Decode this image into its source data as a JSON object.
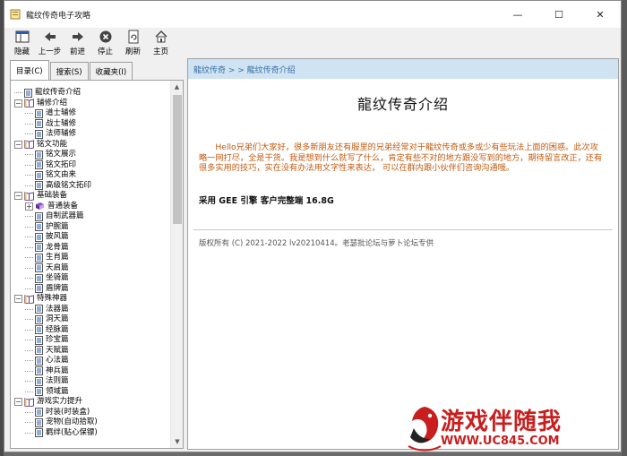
{
  "window": {
    "title": "龍纹传奇电子攻略"
  },
  "window_controls": {
    "minimize": "—",
    "maximize": "☐",
    "close": "✕"
  },
  "toolbar": {
    "hide": "隐藏",
    "back": "上一步",
    "forward": "前进",
    "stop": "停止",
    "refresh": "刷新",
    "home": "主页"
  },
  "tabs": [
    "目录(C)",
    "搜索(S)",
    "收藏夹(I)"
  ],
  "tree": [
    {
      "level": 0,
      "type": "doc",
      "label": "龍纹传奇介绍"
    },
    {
      "level": 0,
      "type": "book",
      "expander": "−",
      "label": "辅修介绍"
    },
    {
      "level": 1,
      "type": "doc",
      "label": "道士辅修"
    },
    {
      "level": 1,
      "type": "doc",
      "label": "战士辅修"
    },
    {
      "level": 1,
      "type": "doc",
      "label": "法师辅修"
    },
    {
      "level": 0,
      "type": "book",
      "expander": "−",
      "label": "铭文功能"
    },
    {
      "level": 1,
      "type": "doc",
      "label": "铭文展示"
    },
    {
      "level": 1,
      "type": "doc",
      "label": "铭文拓印"
    },
    {
      "level": 1,
      "type": "doc",
      "label": "铭文由来"
    },
    {
      "level": 1,
      "type": "doc",
      "label": "高级铭文拓印"
    },
    {
      "level": 0,
      "type": "book",
      "expander": "−",
      "label": "基础装备"
    },
    {
      "level": 1,
      "type": "book-closed",
      "expander": "+",
      "label": "普通装备"
    },
    {
      "level": 1,
      "type": "doc",
      "label": "自制武器篇"
    },
    {
      "level": 1,
      "type": "doc",
      "label": "护腕篇"
    },
    {
      "level": 1,
      "type": "doc",
      "label": "披风篇"
    },
    {
      "level": 1,
      "type": "doc",
      "label": "龙骨篇"
    },
    {
      "level": 1,
      "type": "doc",
      "label": "生肖篇"
    },
    {
      "level": 1,
      "type": "doc",
      "label": "天启篇"
    },
    {
      "level": 1,
      "type": "doc",
      "label": "坐骑篇"
    },
    {
      "level": 1,
      "type": "doc",
      "label": "盾牌篇"
    },
    {
      "level": 0,
      "type": "book",
      "expander": "−",
      "label": "特殊神器"
    },
    {
      "level": 1,
      "type": "doc",
      "label": "法器篇"
    },
    {
      "level": 1,
      "type": "doc",
      "label": "洞天篇"
    },
    {
      "level": 1,
      "type": "doc",
      "label": "经脉篇"
    },
    {
      "level": 1,
      "type": "doc",
      "label": "珍宝篇"
    },
    {
      "level": 1,
      "type": "doc",
      "label": "天赋篇"
    },
    {
      "level": 1,
      "type": "doc",
      "label": "心法篇"
    },
    {
      "level": 1,
      "type": "doc",
      "label": "神兵篇"
    },
    {
      "level": 1,
      "type": "doc",
      "label": "法则篇"
    },
    {
      "level": 1,
      "type": "doc",
      "label": "领域篇"
    },
    {
      "level": 0,
      "type": "book",
      "expander": "−",
      "label": "游戏实力提升"
    },
    {
      "level": 1,
      "type": "doc",
      "label": "时装(时装盒)"
    },
    {
      "level": 1,
      "type": "doc",
      "label": "宠物(自动拾取)"
    },
    {
      "level": 1,
      "type": "doc",
      "label": "羁绊(贴心保镖)"
    }
  ],
  "content": {
    "breadcrumb": "龍纹传奇 > > 龍纹传奇介绍",
    "title": "龍纹传奇介绍",
    "intro": "Hello兄弟们大家好，很多新朋友还有服里的兄弟经常对于龍纹传奇或多或少有些玩法上面的困惑。此次攻略一网打尽，全是干货。我是想到什么就写了什么，肯定有些不对的地方跟没写到的地方，期待留言改正，还有很多实用的技巧，实在没有办法用文字性来表达， 可以在群内跟小伙伴们咨询沟通哦。",
    "version": "采用 GEE 引擎  客户完整端 16.8G",
    "footer": "版权所有 (C) 2021-2022 lv20210414。老瑟批论坛与萝卜论坛专供"
  },
  "watermark": {
    "text": "游戏伴随我",
    "url": "WWW.UC845.COM"
  },
  "colors": {
    "intro_text": "#c05a10",
    "header_bg": "#cfe3f3",
    "header_text": "#3d6fa5",
    "watermark": "#c81e1e"
  }
}
